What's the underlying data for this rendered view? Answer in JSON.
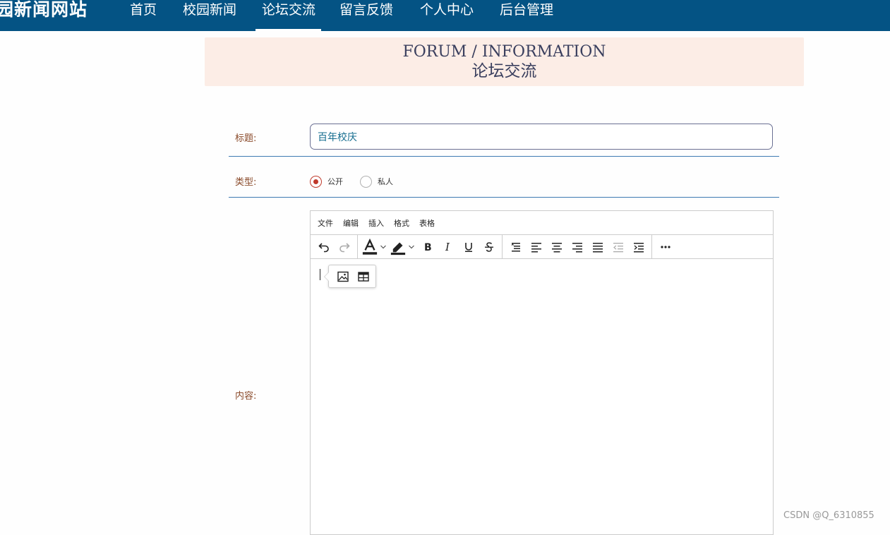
{
  "header": {
    "site_title": "园新闻网站",
    "nav": [
      {
        "label": "首页"
      },
      {
        "label": "校园新闻"
      },
      {
        "label": "论坛交流",
        "active": true
      },
      {
        "label": "留言反馈"
      },
      {
        "label": "个人中心"
      },
      {
        "label": "后台管理"
      }
    ]
  },
  "banner": {
    "title_en": "FORUM / INFORMATION",
    "title_cn": "论坛交流"
  },
  "form": {
    "title_label": "标题:",
    "title_value": "百年校庆",
    "type_label": "类型:",
    "type_options": [
      {
        "label": "公开",
        "selected": true
      },
      {
        "label": "私人",
        "selected": false
      }
    ],
    "content_label": "内容:"
  },
  "editor": {
    "menu": [
      "文件",
      "编辑",
      "插入",
      "格式",
      "表格"
    ],
    "toolbar_icons": [
      "undo-icon",
      "redo-icon",
      "text-color-icon",
      "highlight-color-icon",
      "bold-icon",
      "italic-icon",
      "underline-icon",
      "strikethrough-icon",
      "line-height-icon",
      "align-left-icon",
      "align-center-icon",
      "align-right-icon",
      "align-justify-icon",
      "outdent-icon",
      "indent-icon",
      "more-icon"
    ],
    "quick_insert_icons": [
      "image-icon",
      "table-icon"
    ]
  },
  "watermark": "CSDN @Q_6310855",
  "colors": {
    "nav_bg": "#045384",
    "banner_bg": "#fcede6",
    "label": "#8a4a2a",
    "input_text": "#156d8f",
    "divider": "#3e7ab2",
    "radio_active": "#c0392b"
  }
}
